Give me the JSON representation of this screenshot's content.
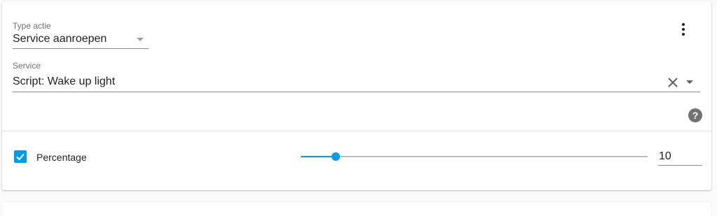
{
  "action_type": {
    "label": "Type actie",
    "value": "Service aanroepen"
  },
  "service": {
    "label": "Service",
    "value": "Script: Wake up light"
  },
  "icons": {
    "menu": "dots-vertical-icon",
    "clear": "close-icon",
    "dropdown": "menu-down-icon",
    "help": "help-circle-icon",
    "help_glyph": "?",
    "check": "check-icon"
  },
  "parameter": {
    "enabled": true,
    "label": "Percentage",
    "value": "10",
    "min": 0,
    "max": 100,
    "level": 10
  },
  "colors": {
    "accent": "#039be5",
    "track": "#bdbdbd",
    "text": "#212121",
    "secondary_text": "#6f6f6f"
  }
}
